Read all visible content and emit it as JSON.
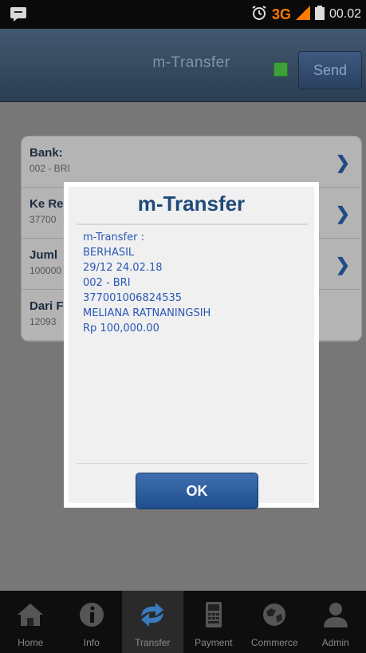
{
  "status_bar": {
    "network": "3G",
    "time": "00.02"
  },
  "app": {
    "title": "m-Transfer",
    "send_label": "Send"
  },
  "form": {
    "rows": [
      {
        "label": "Bank:",
        "value": "002 - BRI"
      },
      {
        "label": "Ke Re",
        "value": "37700"
      },
      {
        "label": "Juml",
        "value": "100000"
      },
      {
        "label": "Dari F",
        "value": "12093"
      }
    ]
  },
  "dialog": {
    "title": "m-Transfer",
    "lines": [
      "m-Transfer :",
      "BERHASIL",
      "29/12 24.02.18",
      "002 - BRI",
      "377001006824535",
      "MELIANA RATNANINGSIH",
      "Rp 100,000.00"
    ],
    "ok_label": "OK"
  },
  "bottom_nav": [
    {
      "label": "Home",
      "icon": "home-icon"
    },
    {
      "label": "Info",
      "icon": "info-icon"
    },
    {
      "label": "Transfer",
      "icon": "transfer-icon"
    },
    {
      "label": "Payment",
      "icon": "payment-icon"
    },
    {
      "label": "Commerce",
      "icon": "commerce-icon"
    },
    {
      "label": "Admin",
      "icon": "admin-icon"
    }
  ],
  "colors": {
    "accent": "#1f4a7a",
    "status_dot": "#3da03a",
    "network": "#ff7a00",
    "dialog_text": "#2a57b7"
  }
}
